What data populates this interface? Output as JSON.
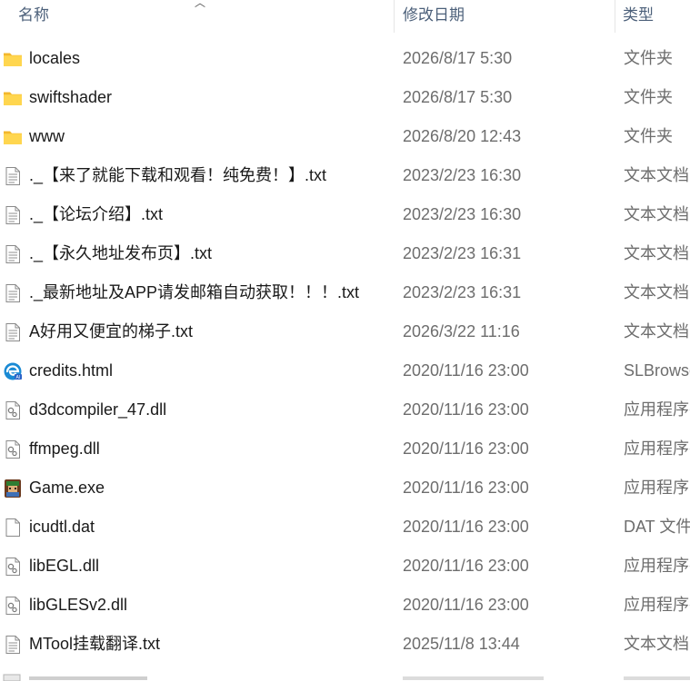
{
  "header": {
    "name": "名称",
    "date_modified": "修改日期",
    "type": "类型"
  },
  "rows": [
    {
      "name": "locales",
      "date": "2026/8/17 5:30",
      "type": "文件夹",
      "icon": "folder-icon"
    },
    {
      "name": "swiftshader",
      "date": "2026/8/17 5:30",
      "type": "文件夹",
      "icon": "folder-icon"
    },
    {
      "name": "www",
      "date": "2026/8/20 12:43",
      "type": "文件夹",
      "icon": "folder-icon"
    },
    {
      "name": "._【来了就能下载和观看！纯免费！】.txt",
      "date": "2023/2/23 16:30",
      "type": "文本文档",
      "icon": "text-file-icon"
    },
    {
      "name": "._【论坛介绍】.txt",
      "date": "2023/2/23 16:30",
      "type": "文本文档",
      "icon": "text-file-icon"
    },
    {
      "name": "._【永久地址发布页】.txt",
      "date": "2023/2/23 16:31",
      "type": "文本文档",
      "icon": "text-file-icon"
    },
    {
      "name": "._最新地址及APP请发邮箱自动获取！！！.txt",
      "date": "2023/2/23 16:31",
      "type": "文本文档",
      "icon": "text-file-icon"
    },
    {
      "name": "A好用又便宜的梯子.txt",
      "date": "2026/3/22 11:16",
      "type": "文本文档",
      "icon": "text-file-icon"
    },
    {
      "name": "credits.html",
      "date": "2020/11/16 23:00",
      "type": "SLBrowser",
      "icon": "browser-html-icon"
    },
    {
      "name": "d3dcompiler_47.dll",
      "date": "2020/11/16 23:00",
      "type": "应用程序扩展",
      "icon": "dll-file-icon"
    },
    {
      "name": "ffmpeg.dll",
      "date": "2020/11/16 23:00",
      "type": "应用程序扩展",
      "icon": "dll-file-icon"
    },
    {
      "name": "Game.exe",
      "date": "2020/11/16 23:00",
      "type": "应用程序",
      "icon": "game-exe-icon"
    },
    {
      "name": "icudtl.dat",
      "date": "2020/11/16 23:00",
      "type": "DAT 文件",
      "icon": "blank-file-icon"
    },
    {
      "name": "libEGL.dll",
      "date": "2020/11/16 23:00",
      "type": "应用程序扩展",
      "icon": "dll-file-icon"
    },
    {
      "name": "libGLESv2.dll",
      "date": "2020/11/16 23:00",
      "type": "应用程序扩展",
      "icon": "dll-file-icon"
    },
    {
      "name": "MTool挂载翻译.txt",
      "date": "2025/11/8 13:44",
      "type": "文本文档",
      "icon": "text-file-icon"
    }
  ]
}
